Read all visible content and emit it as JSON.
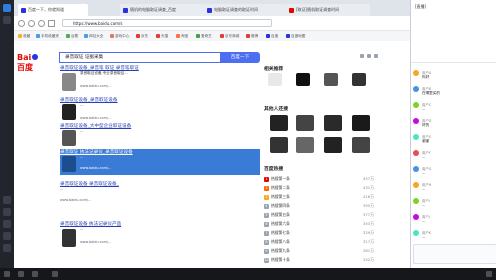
{
  "browser": {
    "tabs": [
      {
        "label": "百度一下，你就知道"
      },
      {
        "label": "随机的电脑取证调查_百度"
      },
      {
        "label": "电脑取证调查的取证时间"
      },
      {
        "label": "[取证]随机取证调查时间"
      }
    ],
    "url": "https://www.baidu.com/s",
    "bookmarks": [
      "收藏",
      "手机收藏夹",
      "谷歌",
      "网址大全",
      "游戏中心",
      "京东",
      "天猫",
      "淘宝",
      "爱奇艺",
      "京东商城",
      "微博",
      "百度",
      "百度地图"
    ]
  },
  "search": {
    "logo_text": "Bai",
    "logo_text2": "百度",
    "query": "录音取证 证据采集",
    "button": "百度一下"
  },
  "results": [
    {
      "title": "录音取证设备_录音笔 取证 录音笔取证",
      "desc": "录音取证设备,专业录音取证...",
      "url": "www.baidu.com/..."
    },
    {
      "title": "录音取证设备_录音取证设备",
      "desc": "...",
      "url": "www.baidu.com/..."
    },
    {
      "title": "录音取证设备_大中型企业取证设备",
      "desc": "...",
      "url": "www.baidu.com/..."
    },
    {
      "title": "录音取证 执法记录仪_录音取证设备",
      "desc": "...",
      "url": "www.baidu.com/..."
    },
    {
      "title": "录音取证设备 录音取证设备_",
      "desc": "...",
      "url": "www.baidu.com/..."
    },
    {
      "title": "录音取证设备 执法记录仪产品",
      "desc": "...",
      "url": "www.baidu.com/..."
    }
  ],
  "right_rail": {
    "section1": "相关推荐",
    "section2": "其他人还搜",
    "section3": "百度热搜",
    "hot": [
      {
        "rank": "1",
        "text": "热搜第一条",
        "value": "457万"
      },
      {
        "rank": "2",
        "text": "热搜第二条",
        "value": "431万"
      },
      {
        "rank": "3",
        "text": "热搜第三条",
        "value": "416万"
      },
      {
        "rank": "4",
        "text": "热搜第四条",
        "value": "395万"
      },
      {
        "rank": "5",
        "text": "热搜第五条",
        "value": "377万"
      },
      {
        "rank": "6",
        "text": "热搜第六条",
        "value": "353万"
      },
      {
        "rank": "7",
        "text": "热搜第七条",
        "value": "329万"
      },
      {
        "rank": "8",
        "text": "热搜第八条",
        "value": "317万"
      },
      {
        "rank": "9",
        "text": "热搜第九条",
        "value": "281万"
      },
      {
        "rank": "10",
        "text": "热搜第十条",
        "value": "252万"
      }
    ]
  },
  "chat": {
    "title": "[直播]",
    "messages": [
      {
        "name": "用户A",
        "text": "你好"
      },
      {
        "name": "用户B",
        "text": "在哪里买的"
      },
      {
        "name": "用户C",
        "text": "..."
      },
      {
        "name": "用户D",
        "text": "好的"
      },
      {
        "name": "用户E",
        "text": "谢谢"
      },
      {
        "name": "用户F",
        "text": "..."
      },
      {
        "name": "用户G",
        "text": "..."
      },
      {
        "name": "用户H",
        "text": "..."
      },
      {
        "name": "用户I",
        "text": "..."
      },
      {
        "name": "用户J",
        "text": "..."
      },
      {
        "name": "用户K",
        "text": "..."
      }
    ]
  },
  "colors": {
    "baidu_red": "#e10601",
    "baidu_blue": "#4e6ef2",
    "link": "#2440b3",
    "selection": "#3a7bd5"
  }
}
